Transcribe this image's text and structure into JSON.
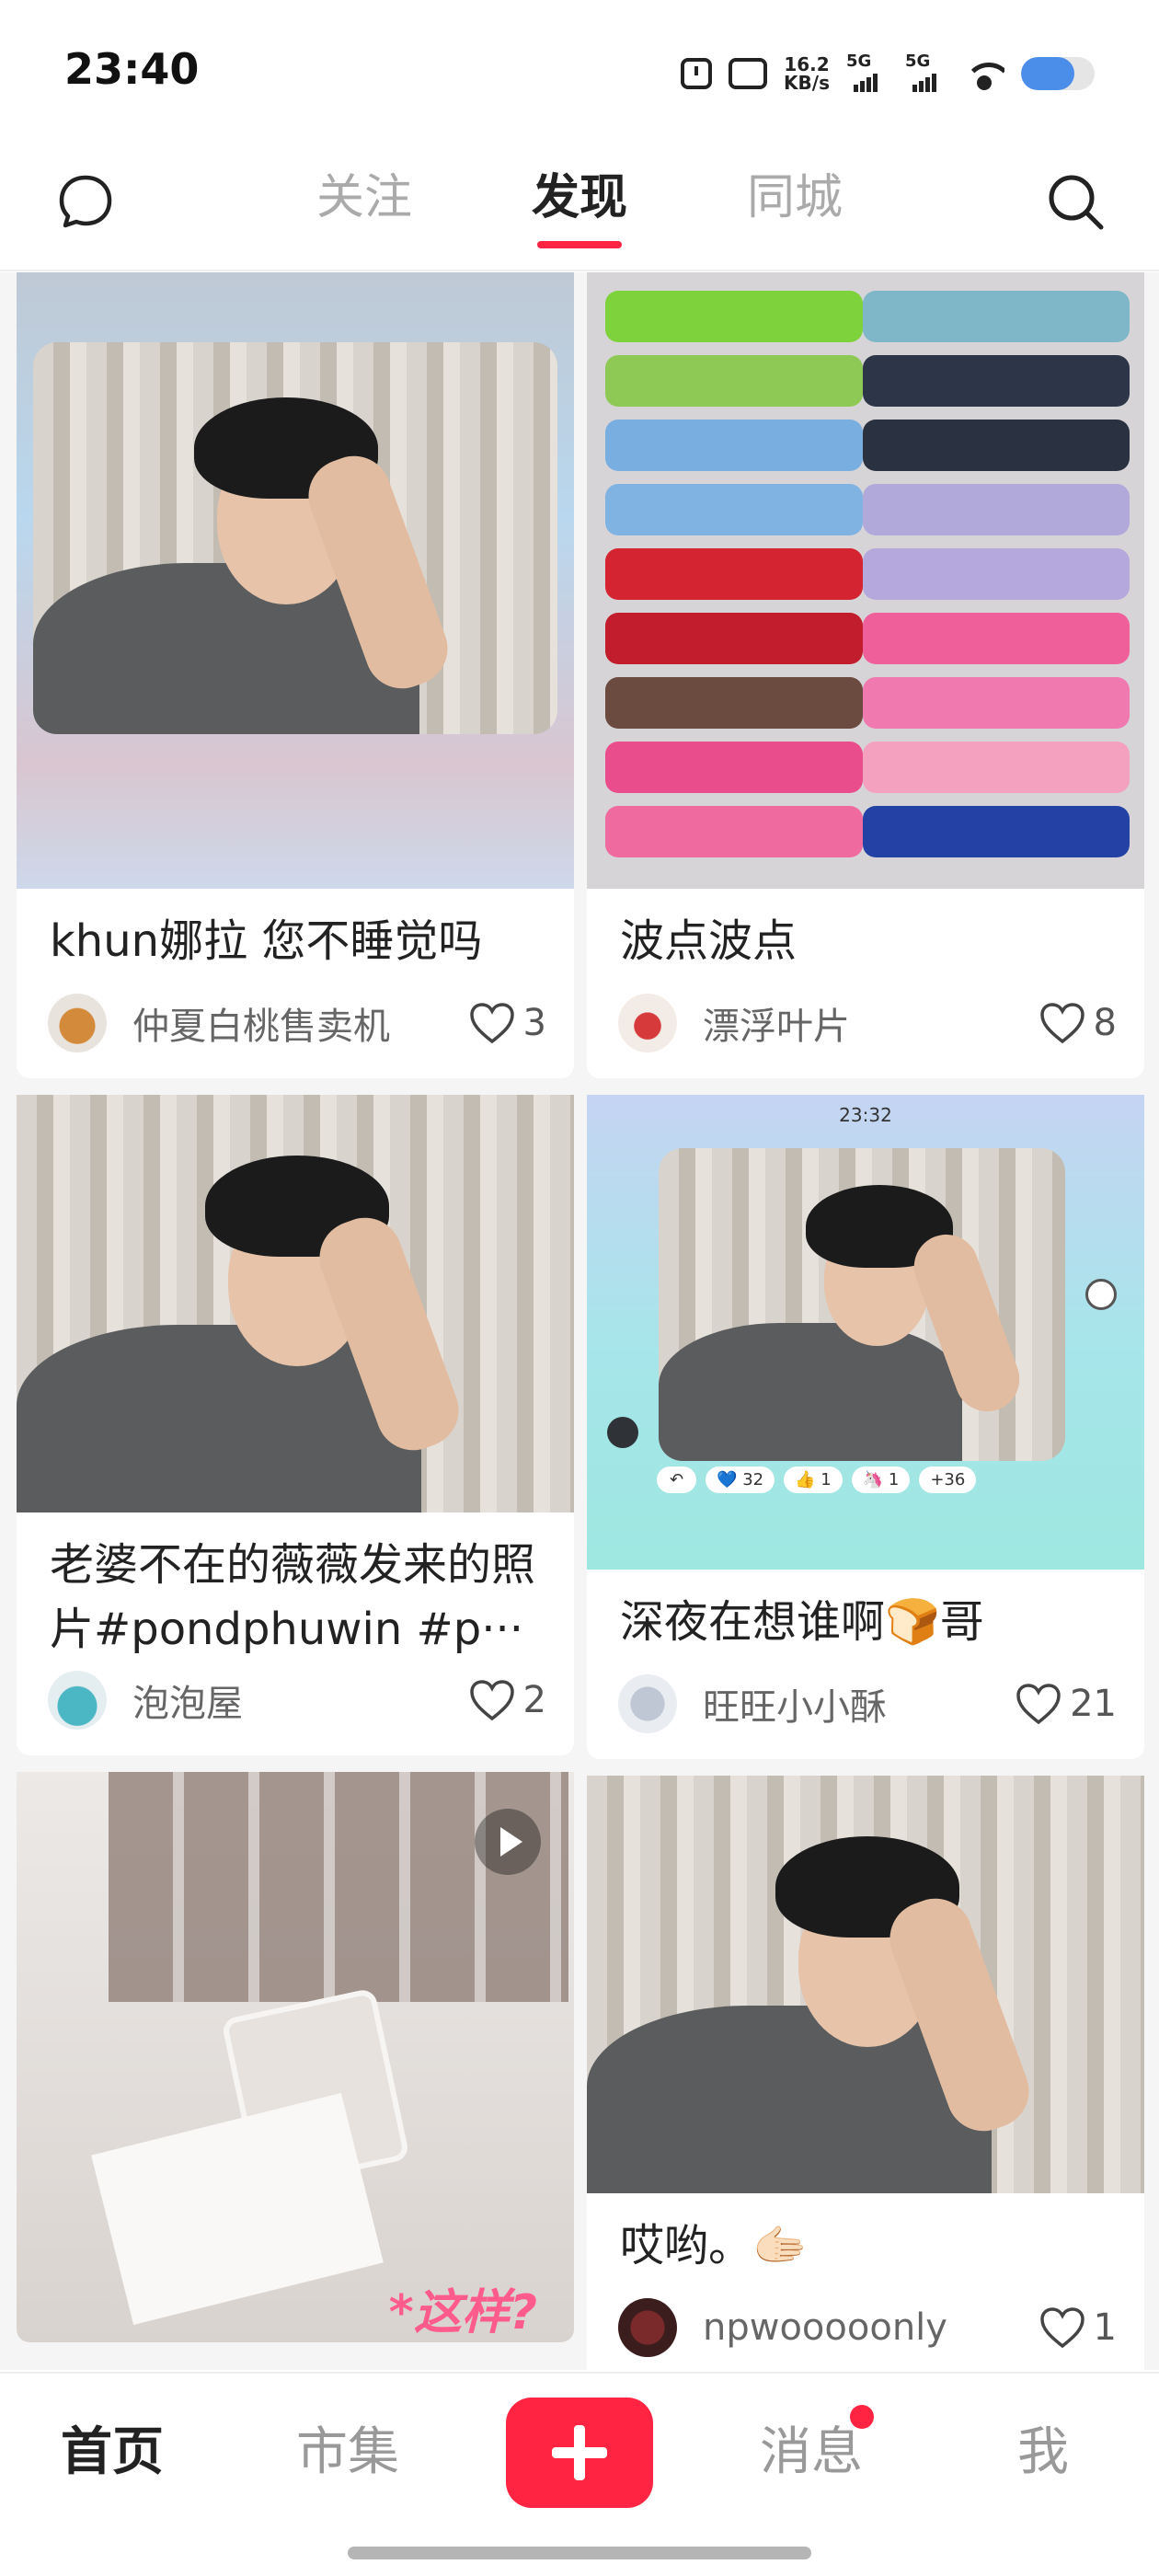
{
  "status_bar": {
    "time": "23:40",
    "net_speed_value": "16.2",
    "net_speed_unit": "KB/s",
    "sim1": "5G",
    "sim2": "5G",
    "battery_level": 0.72
  },
  "top_nav": {
    "tabs": [
      {
        "label": "关注",
        "active": false
      },
      {
        "label": "发现",
        "active": true
      },
      {
        "label": "同城",
        "active": false
      }
    ]
  },
  "feed": {
    "left": [
      {
        "title": "khun娜拉 您不睡觉吗",
        "author": "仲夏白桃售卖机",
        "likes": "3"
      },
      {
        "title": "老婆不在的薇薇发来的照片#pondphuwin #p···",
        "author": "泡泡屋",
        "likes": "2"
      },
      {
        "title": "",
        "author": "",
        "likes": "",
        "overlay_text": "*这样?"
      }
    ],
    "right": [
      {
        "title": "波点波点",
        "author": "漂浮叶片",
        "likes": "8"
      },
      {
        "title": "深夜在想谁啊🍞哥",
        "author": "旺旺小小酥",
        "likes": "21",
        "inner_screenshot": {
          "time": "23:32",
          "reactions": [
            "💙 32",
            "👍 1",
            "🦄 1",
            "+36"
          ]
        }
      },
      {
        "title": "哎哟。🫱🏻",
        "author": "npwooooonly",
        "likes": "1"
      }
    ]
  },
  "bottom_nav": {
    "home": "首页",
    "market": "市集",
    "messages": "消息",
    "me": "我"
  },
  "colors": {
    "accent": "#ff2442",
    "text": "#222222",
    "muted": "#999999"
  }
}
